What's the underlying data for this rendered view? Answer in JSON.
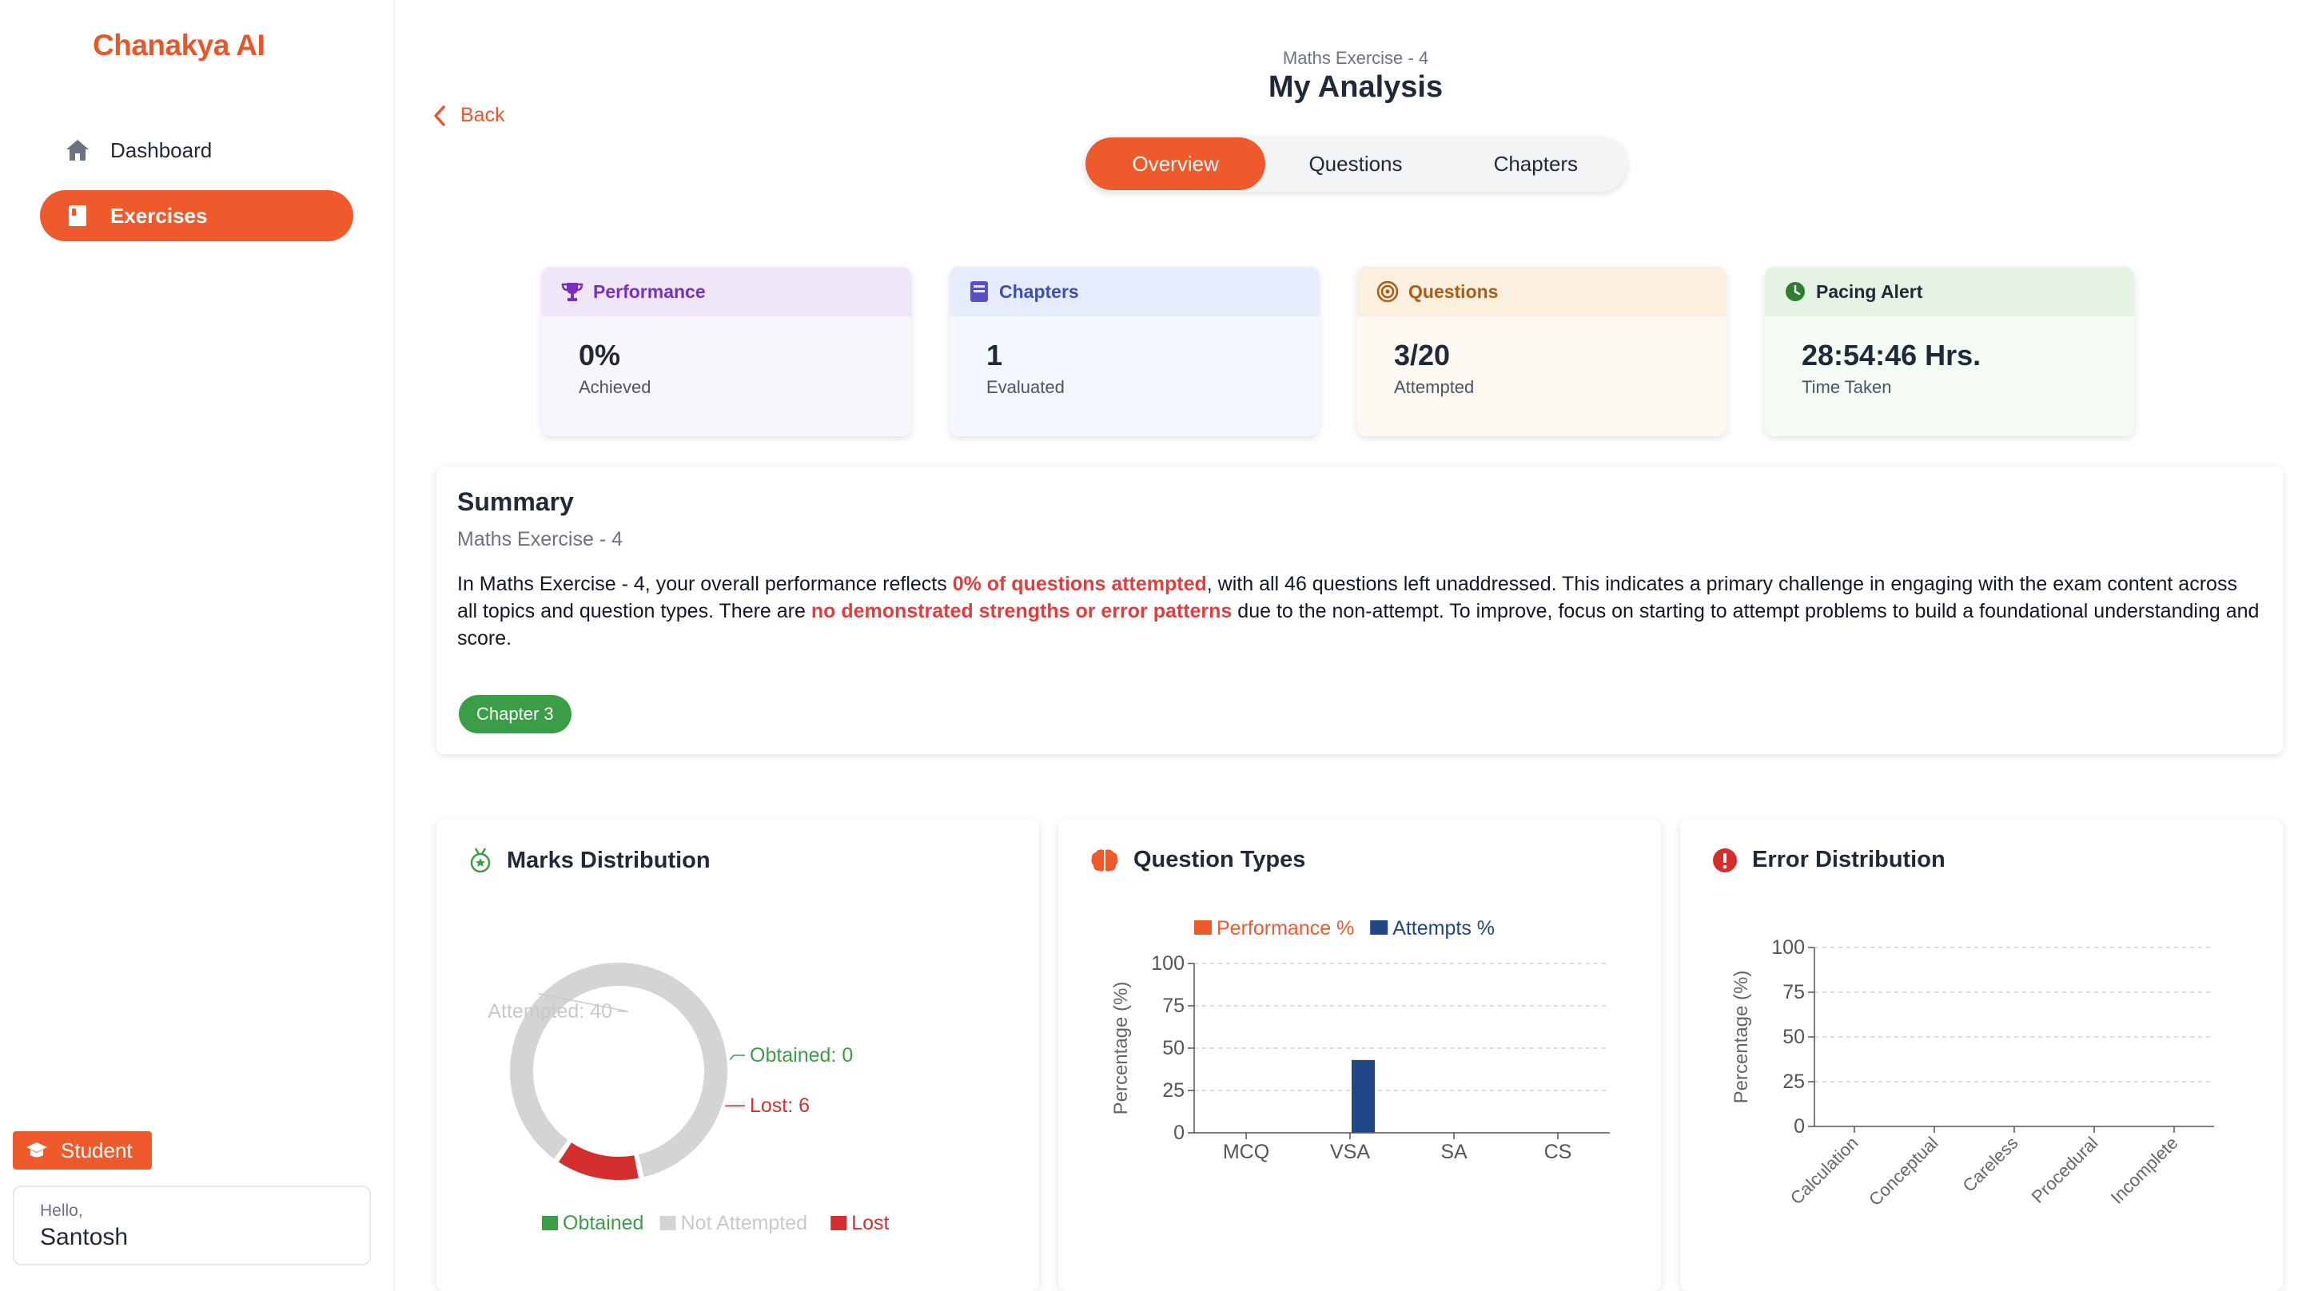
{
  "sidebar": {
    "logo": "Chanakya AI",
    "nav": [
      {
        "label": "Dashboard",
        "icon": "home-icon"
      },
      {
        "label": "Exercises",
        "icon": "book-icon",
        "active": true
      }
    ],
    "role": "Student",
    "user": {
      "greeting": "Hello,",
      "name": "Santosh"
    }
  },
  "header": {
    "subtitle": "Maths Exercise - 4",
    "title": "My Analysis",
    "back": "Back",
    "tabs": [
      "Overview",
      "Questions",
      "Chapters"
    ],
    "active_tab": "Overview"
  },
  "stats": [
    {
      "title": "Performance",
      "icon": "trophy-icon",
      "value": "0%",
      "label": "Achieved"
    },
    {
      "title": "Chapters",
      "icon": "book-icon",
      "value": "1",
      "label": "Evaluated"
    },
    {
      "title": "Questions",
      "icon": "target-icon",
      "value": "3/20",
      "label": "Attempted"
    },
    {
      "title": "Pacing Alert",
      "icon": "clock-icon",
      "value": "28:54:46 Hrs.",
      "label": "Time Taken"
    }
  ],
  "summary": {
    "title": "Summary",
    "subtitle": "Maths Exercise - 4",
    "text_1": "In Maths Exercise - 4, your overall performance reflects ",
    "highlight_1": "0% of questions attempted",
    "text_2": ", with all 46 questions left unaddressed. This indicates a primary challenge in engaging with the exam content across all topics and question types. There are ",
    "highlight_2": "no demonstrated strengths or error patterns",
    "text_3": " due to the non-attempt. To improve, focus on starting to attempt problems to build a foundational understanding and score.",
    "chip": "Chapter 3"
  },
  "colors": {
    "accent": "#ee5a2b",
    "obtained": "#3b9d46",
    "not_attempted": "#d4d4d4",
    "lost": "#d32f2f",
    "performance": "#ee5a2b",
    "attempts": "#1f4788"
  },
  "chart_data": [
    {
      "type": "pie",
      "title": "Marks Distribution",
      "icon": "medal-icon",
      "slices": [
        {
          "name": "Obtained",
          "value": 0,
          "label": "Obtained: 0"
        },
        {
          "name": "Not Attempted",
          "value": 40,
          "label": "Attempted: 40"
        },
        {
          "name": "Lost",
          "value": 6,
          "label": "Lost: 6"
        }
      ],
      "legend": [
        "Obtained",
        "Not Attempted",
        "Lost"
      ],
      "legend_position": "bottom"
    },
    {
      "type": "bar",
      "title": "Question Types",
      "icon": "brain-icon",
      "categories": [
        "MCQ",
        "VSA",
        "SA",
        "CS"
      ],
      "series": [
        {
          "name": "Performance %",
          "values": [
            0,
            0,
            0,
            0
          ]
        },
        {
          "name": "Attempts %",
          "values": [
            0,
            43,
            0,
            0
          ]
        }
      ],
      "ylabel": "Percentage (%)",
      "ylim": [
        0,
        100
      ],
      "yticks": [
        "0",
        "25",
        "50",
        "75",
        "100"
      ],
      "grid": true,
      "legend_position": "top"
    },
    {
      "type": "bar",
      "title": "Error Distribution",
      "icon": "alert-icon",
      "categories": [
        "Calculation",
        "Conceptual",
        "Careless",
        "Procedural",
        "Incomplete"
      ],
      "series": [
        {
          "values": [
            0,
            0,
            0,
            0,
            0
          ]
        }
      ],
      "ylabel": "Percentage (%)",
      "ylim": [
        0,
        100
      ],
      "yticks": [
        "0",
        "25",
        "50",
        "75",
        "100"
      ],
      "grid": true
    }
  ]
}
